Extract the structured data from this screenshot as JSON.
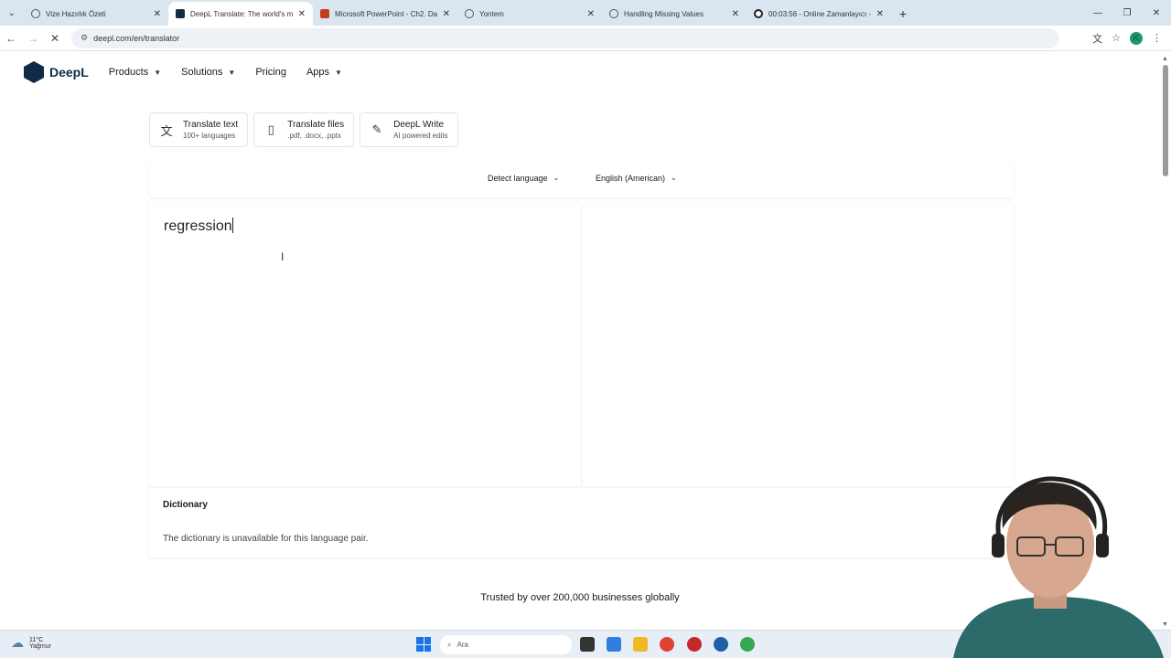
{
  "browser": {
    "tabs": [
      {
        "title": "Vize Hazırlık Özeti",
        "icon": "globe-icon"
      },
      {
        "title": "DeepL Translate: The world's m",
        "icon": "deepl-icon",
        "active": true
      },
      {
        "title": "Microsoft PowerPoint - Ch2. Da",
        "icon": "powerpoint-icon"
      },
      {
        "title": "Yontem",
        "icon": "globe-icon"
      },
      {
        "title": "Handling Missing Values",
        "icon": "globe-icon"
      },
      {
        "title": "00:03:56 - Online Zamanlayıcı -",
        "icon": "timer-icon"
      }
    ],
    "url": "deepl.com/en/translator",
    "profile_initial": "K"
  },
  "header": {
    "logo_text": "DeepL",
    "nav": [
      "Products",
      "Solutions",
      "Pricing",
      "Apps"
    ]
  },
  "modes": [
    {
      "title": "Translate text",
      "subtitle": "100+ languages",
      "icon": "translate-icon"
    },
    {
      "title": "Translate files",
      "subtitle": ".pdf, .docx, .pptx",
      "icon": "document-icon"
    },
    {
      "title": "DeepL Write",
      "subtitle": "AI powered edits",
      "icon": "magic-wand-icon"
    }
  ],
  "languages": {
    "source": "Detect language",
    "target": "English (American)"
  },
  "source_text": "regression",
  "dictionary": {
    "title": "Dictionary",
    "message": "The dictionary is unavailable for this language pair."
  },
  "trusted": "Trusted by over 200,000 businesses globally",
  "taskbar": {
    "temp": "11°C",
    "weather": "Yağmur",
    "search_placeholder": "Ara"
  },
  "colors": {
    "brand": "#0f2b46",
    "tabstrip": "#d9e6f0"
  }
}
